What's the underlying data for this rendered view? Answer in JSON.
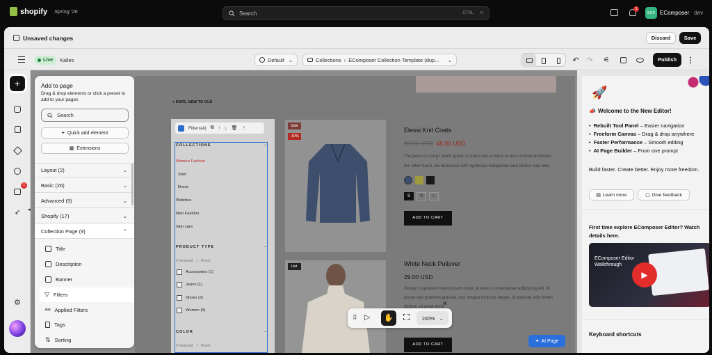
{
  "topbar": {
    "brand": "shopify",
    "edition": "Spring '26",
    "search_placeholder": "Search",
    "shortcut_1": "CTRL",
    "shortcut_2": "K",
    "notif_count": "1",
    "store_initials": "EC6",
    "store_name": "EComposer",
    "store_tag": "dev"
  },
  "unsaved": {
    "title": "Unsaved changes",
    "discard": "Discard",
    "save": "Save"
  },
  "toolbar": {
    "live": "Live",
    "theme": "Kalles",
    "default_label": "Default",
    "crumb_root": "Collections",
    "crumb_page": "EComposer Collection Template (dup...",
    "publish": "Publish"
  },
  "rail": {
    "history_badge": "1"
  },
  "add_panel": {
    "title": "Add to page",
    "subtitle": "Drag & drop elements or click a preset to add to your pages",
    "search_placeholder": "Search",
    "quick_add": "Quick add element",
    "extensions": "Extensions",
    "categories": [
      {
        "label": "Layout (2)"
      },
      {
        "label": "Basic (26)"
      },
      {
        "label": "Advanced (9)"
      },
      {
        "label": "Shopify (17)"
      },
      {
        "label": "Collection Page (9)"
      }
    ],
    "items": [
      {
        "label": "Title"
      },
      {
        "label": "Description"
      },
      {
        "label": "Banner"
      },
      {
        "label": "Filters"
      },
      {
        "label": "Applied Filters"
      },
      {
        "label": "Tags"
      },
      {
        "label": "Sorting"
      }
    ]
  },
  "canvas": {
    "sort_label": "+ DATE, NEW TO OLD",
    "filter_toolbar": "Filters(4)",
    "collections_heading": "COLLECTIONS",
    "collections": [
      {
        "label": "Women Fashion",
        "active": true
      },
      {
        "label": "Shirt"
      },
      {
        "label": "Dress"
      },
      {
        "label": "Watches"
      },
      {
        "label": "Men Fashion"
      },
      {
        "label": "Skin care"
      }
    ],
    "product_type_heading": "PRODUCT TYPE",
    "selected_text": "0 Selected",
    "sep": "/",
    "reset": "Reset",
    "product_types": [
      "Accessories (1)",
      "Jeans (1)",
      "Shoes (2)",
      "Women (5)"
    ],
    "color_heading": "COLOR"
  },
  "products": [
    {
      "sale_badge": "Sale",
      "discount_badge": "-10%",
      "title": "Elessi Knit Coats",
      "old_price": "50.00 USD",
      "price": "45.00 USD",
      "desc_1": "The point of using Lorem Ipsum is that it has a more-or-less normal distributio",
      "desc_2": "the other hand, we denounce with righteous indignation and dislike men who",
      "sizes": [
        "S",
        "M",
        "L"
      ],
      "cta": "ADD TO CART"
    },
    {
      "hot_badge": "Hot",
      "title": "White Neck Pullover",
      "price": "29.00 USD",
      "desc_1": "Design inspiration lorem ipsum dolor sit amet, consectetuer adipiscing elit. M",
      "desc_2": "ipsum sed pharetra gravida, orci magna rhoncus neque, id pulvinar odio lorem",
      "desc_3": "Nullam sit amet enim",
      "cta": "ADD TO CART"
    }
  ],
  "bottom_bar": {
    "zoom": "100%"
  },
  "ai_page": "AI Page",
  "right_panel": {
    "welcome_title": "Welcome to the New Editor!",
    "bullets": [
      {
        "bold": "Rebuilt Tool Panel",
        "rest": " – Easier navigation"
      },
      {
        "bold": "Freeform Canvas",
        "rest": " – Drag & drop anywhere"
      },
      {
        "bold": "Faster Performance",
        "rest": " – Smooth editing"
      },
      {
        "bold": "AI Page Builder",
        "rest": " – From one prompt"
      }
    ],
    "tagline": "Build faster. Create better. Enjoy more freedom.",
    "learn_more": "Learn more",
    "give_feedback": "Give feedback",
    "explore_text": "First time explore EComposer Editor? Watch details here.",
    "video_title": "EComposer Editor Walkthrough",
    "shortcuts": "Keyboard shortcuts"
  },
  "colors": {
    "accent": "#2c6ecb",
    "sale": "#d72c0d",
    "dark": "#111111"
  }
}
